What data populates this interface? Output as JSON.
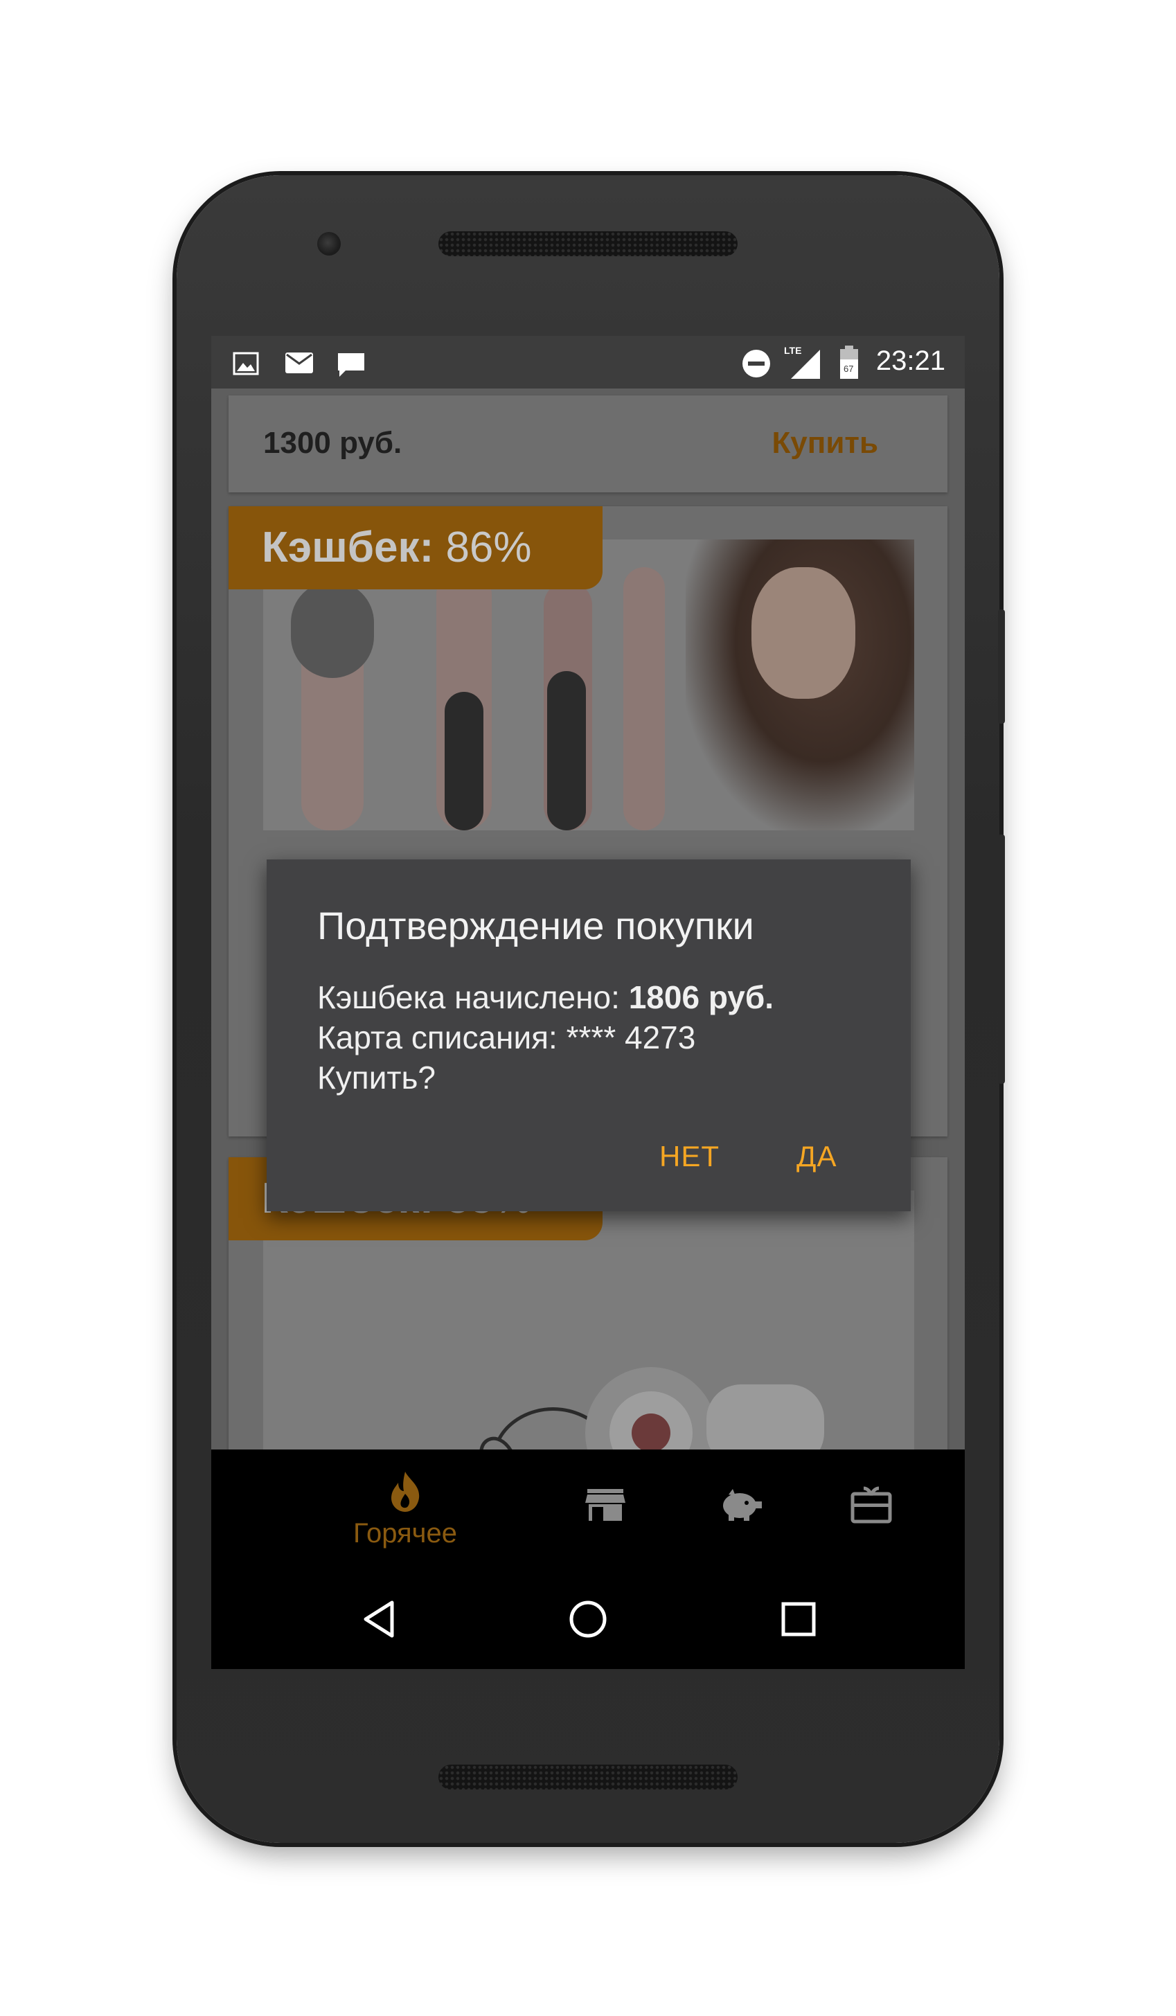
{
  "status_bar": {
    "time": "23:21",
    "left_icons": [
      "image-icon",
      "mail-icon",
      "chat-icon"
    ],
    "right_icons": [
      "do-not-disturb-icon",
      "lte-signal-icon",
      "battery-icon"
    ],
    "network_label": "LTE"
  },
  "buy_bar": {
    "price": "1300 руб.",
    "buy_label": "Купить"
  },
  "cards": [
    {
      "cashback_label": "Кэшбек:",
      "cashback_value": "86%",
      "image": "hair-brush-straighteners-photo"
    },
    {
      "cashback_label": "Кэшбек:",
      "cashback_value": "88%",
      "image": "headphones-photo"
    }
  ],
  "dialog": {
    "title": "Подтверждение покупки",
    "line1_prefix": "Кэшбека начислено: ",
    "line1_value": "1806 руб.",
    "line2": "Карта списания: **** 4273",
    "line3": "Купить?",
    "no_label": "НЕТ",
    "yes_label": "ДА"
  },
  "bottom_nav": {
    "items": [
      {
        "icon": "flame-icon",
        "label": "Горячее",
        "active": true
      },
      {
        "icon": "store-icon",
        "label": ""
      },
      {
        "icon": "piggy-bank-icon",
        "label": ""
      },
      {
        "icon": "gift-card-icon",
        "label": ""
      }
    ]
  },
  "system_nav": [
    "back-icon",
    "home-icon",
    "recents-icon"
  ],
  "colors": {
    "accent": "#f5a623",
    "accent_dimmed": "#87550b",
    "dialog_bg": "#424244",
    "nav_bg": "#000000"
  }
}
